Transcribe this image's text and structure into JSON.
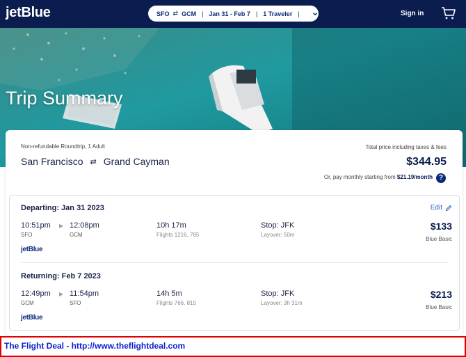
{
  "header": {
    "logo_text": "jetBlue",
    "search": {
      "origin": "SFO",
      "swap_glyph": "⇄",
      "destination": "GCM",
      "dates": "Jan 31 - Feb 7",
      "travelers": "1 Traveler",
      "separator": "|"
    },
    "signin_label": "Sign in",
    "cart_icon": "shopping-cart-icon"
  },
  "hero": {
    "title": "Trip Summary"
  },
  "summary": {
    "trip_meta": "Non-refundable Roundtrip, 1 Adult",
    "origin_city": "San Francisco",
    "swap_glyph": "⇄",
    "destination_city": "Grand Cayman",
    "total_label": "Total price including taxes & fees",
    "total_price": "$344.95",
    "monthly_prefix": "Or, pay monthly starting from",
    "monthly_amount": "$21.19/month",
    "help_glyph": "?"
  },
  "legs": [
    {
      "title": "Departing: Jan 31 2023",
      "depart_time": "10:51pm",
      "depart_code": "SFO",
      "arrive_time": "12:08pm",
      "arrive_code": "GCM",
      "duration": "10h 17m",
      "flights": "Flights 1216, 765",
      "stop": "Stop: JFK",
      "layover": "Layover: 50m",
      "price": "$133",
      "fare": "Blue Basic",
      "airline": "jetBlue"
    },
    {
      "title": "Returning: Feb 7 2023",
      "depart_time": "12:49pm",
      "depart_code": "GCM",
      "arrive_time": "11:54pm",
      "arrive_code": "SFO",
      "duration": "14h 5m",
      "flights": "Flights 766, 815",
      "stop": "Stop: JFK",
      "layover": "Layover: 3h 31m",
      "price": "$213",
      "fare": "Blue Basic",
      "airline": "jetBlue"
    }
  ],
  "edit_label": "Edit",
  "arrow_glyph": "▶",
  "banner_text": "The Flight Deal - http://www.theflightdeal.com",
  "colors": {
    "header_bg": "#0b1c4f",
    "accent": "#0b2a7a",
    "link": "#2a66c7",
    "banner_border": "#e00000",
    "banner_text": "#0a1fd0"
  }
}
